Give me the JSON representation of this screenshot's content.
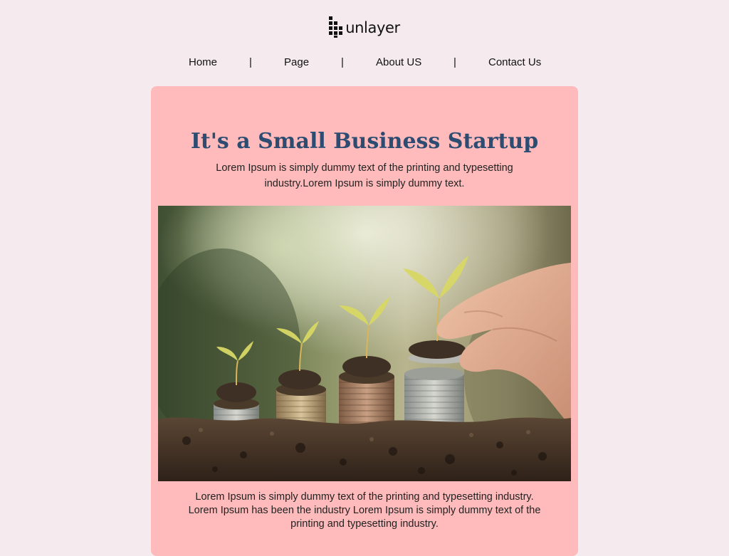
{
  "brand": {
    "logo_text": "unlayer"
  },
  "nav": {
    "items": [
      {
        "label": "Home"
      },
      {
        "label": "Page"
      },
      {
        "label": "About US"
      },
      {
        "label": "Contact Us"
      }
    ],
    "separator": "|"
  },
  "hero": {
    "title": "It's a Small Business Startup",
    "subtitle": "Lorem Ipsum is simply dummy text of the printing and typesetting industry.Lorem Ipsum is simply dummy text."
  },
  "image": {
    "icon": "plant-coins-photo"
  },
  "body": {
    "text": "Lorem Ipsum is simply dummy text of the printing and typesetting industry. Lorem Ipsum has been the industry Lorem Ipsum is simply dummy text of the printing and typesetting industry."
  },
  "colors": {
    "page_background": "#f5ebee",
    "card_background": "#ffbbbb",
    "title_color": "#2c4c72"
  }
}
